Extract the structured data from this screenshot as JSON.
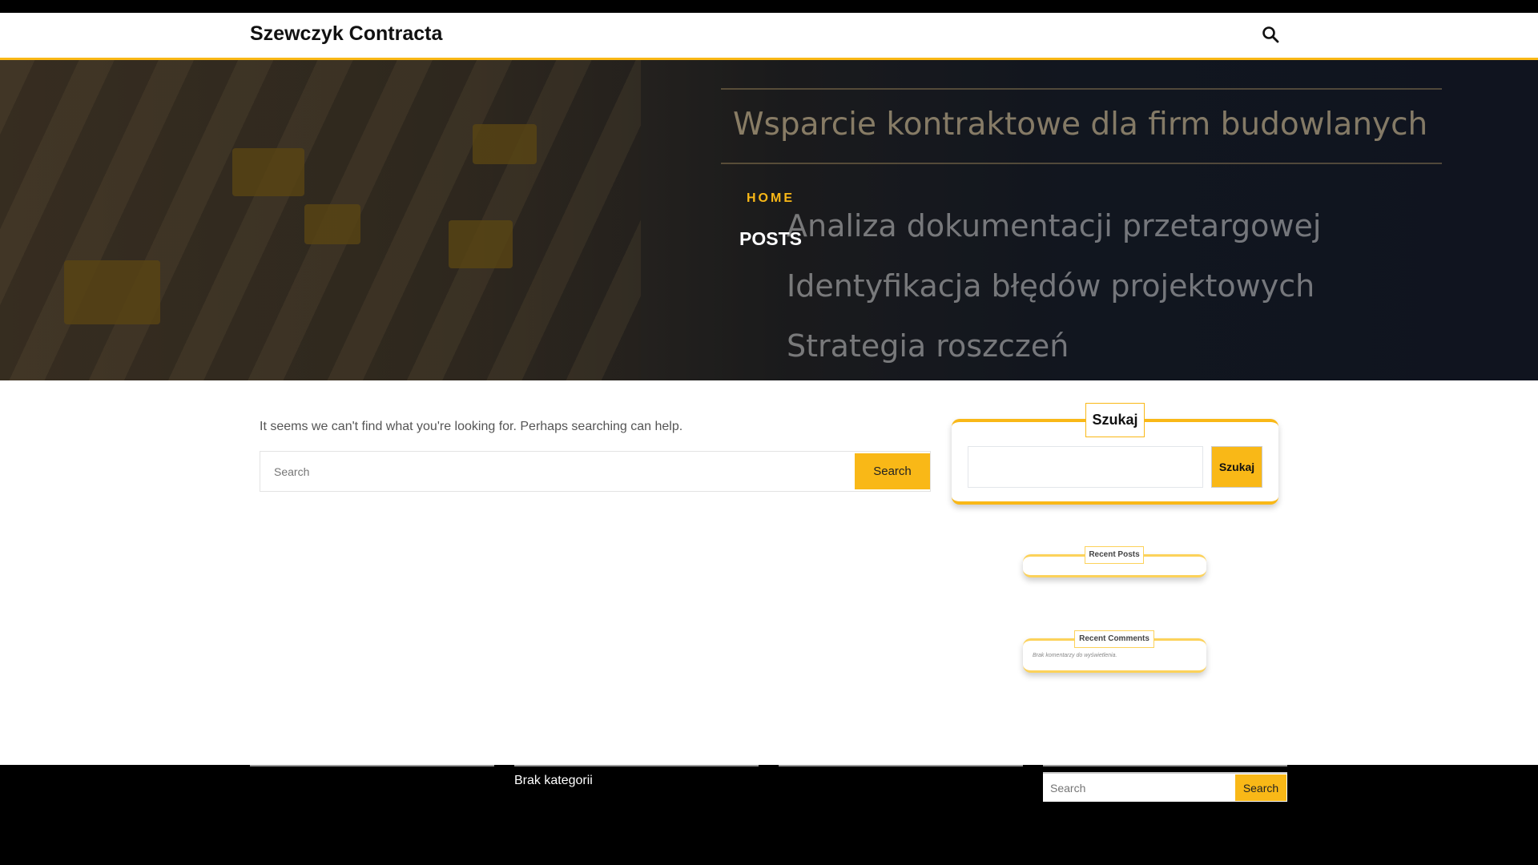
{
  "header": {
    "site_title": "Szewczyk Contracta"
  },
  "hero": {
    "image_text": [
      "Wsparcie kontraktowe dla firm budowlanych",
      "Analiza dokumentacji przetargowej",
      "Identyfikacja błędów projektowych",
      "Strategia roszczeń"
    ],
    "breadcrumb_home": "HOME",
    "page_title": "POSTS"
  },
  "main": {
    "message": "It seems we can't find what you're looking for. Perhaps searching can help.",
    "search_placeholder": "Search",
    "search_button": "Search"
  },
  "sidebar": {
    "search_widget": {
      "title": "Szukaj",
      "button": "Szukaj"
    },
    "recent_posts": {
      "title": "Recent Posts"
    },
    "recent_comments": {
      "title": "Recent Comments",
      "empty": "Brak komentarzy do wyświetlenia."
    }
  },
  "footer": {
    "categories_empty": "Brak kategorii",
    "search_placeholder": "Search",
    "search_button": "Search"
  },
  "colors": {
    "accent": "#f9b817"
  }
}
